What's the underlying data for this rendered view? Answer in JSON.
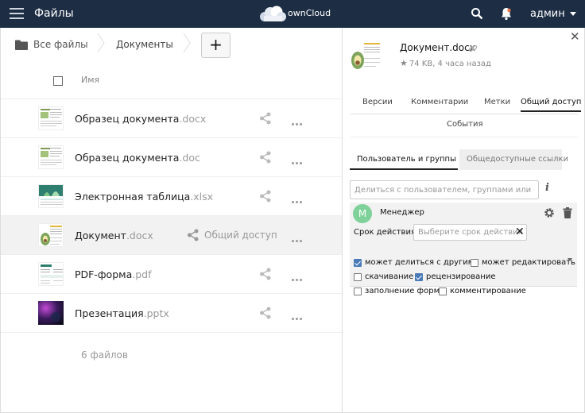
{
  "header": {
    "app_title": "Файлы",
    "brand": "ownCloud",
    "user": "админ",
    "colors": {
      "bar": "#1d2d44"
    }
  },
  "breadcrumb": {
    "items": [
      "Все файлы",
      "Документы"
    ],
    "add_label": "+"
  },
  "list": {
    "column_name": "Имя",
    "rows": [
      {
        "name": "Образец документа",
        "ext": ".docx",
        "icon": "docx-thumbnail",
        "active": false
      },
      {
        "name": "Образец документа",
        "ext": ".doc",
        "icon": "doc-thumbnail",
        "active": false
      },
      {
        "name": "Электронная таблица",
        "ext": ".xlsx",
        "icon": "xlsx-thumbnail",
        "active": false
      },
      {
        "name": "Документ",
        "ext": ".docx",
        "icon": "docx-thumbnail",
        "active": true,
        "share_label": "Общий доступ"
      },
      {
        "name": "PDF-форма",
        "ext": ".pdf",
        "icon": "pdf-thumbnail",
        "active": false
      },
      {
        "name": "Презентация",
        "ext": ".pptx",
        "icon": "pptx-thumbnail",
        "active": false
      }
    ],
    "footer": "6 файлов"
  },
  "sidebar": {
    "file_name": "Документ.docx",
    "file_meta": "74 KB, 4 часа назад",
    "tabs": [
      "Версии",
      "Комментарии",
      "Метки",
      "Общий доступ"
    ],
    "active_tab": "Общий доступ",
    "tab_events": "События",
    "subtabs": [
      "Пользователь и группы",
      "Общедоступные ссылки"
    ],
    "share_placeholder": "Делиться с пользователем, группами или федер",
    "share_entry": {
      "avatar_letter": "М",
      "name": "Менеджер",
      "expiry_label": "Срок действия:",
      "expiry_placeholder": "Выберите срок действия",
      "clear": "✕",
      "permissions": [
        {
          "label": "может делиться с другими",
          "checked": true
        },
        {
          "label": "может редактировать",
          "checked": false
        },
        {
          "label": "скачивание",
          "checked": false
        },
        {
          "label": "рецензирование",
          "checked": true
        },
        {
          "label": "заполнение форм",
          "checked": false
        },
        {
          "label": "комментирование",
          "checked": false
        }
      ]
    },
    "colors": {
      "avatar": "#7fd19a",
      "checkbox": "#4a7bb8"
    }
  }
}
